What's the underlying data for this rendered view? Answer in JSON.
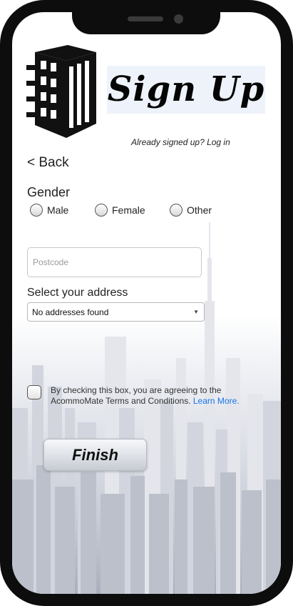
{
  "header": {
    "title": "Sign Up",
    "login_link": "Already signed up? Log in"
  },
  "nav": {
    "back_label": "< Back"
  },
  "gender": {
    "label": "Gender",
    "options": [
      "Male",
      "Female",
      "Other"
    ]
  },
  "postcode": {
    "placeholder": "Postcode",
    "value": ""
  },
  "address": {
    "label": "Select your address",
    "selected": "No addresses found"
  },
  "terms": {
    "text": "By checking this box, you are agreeing to the AcommoMate Terms and Conditions.",
    "link": "Learn More.",
    "checked": false
  },
  "actions": {
    "finish_label": "Finish"
  },
  "colors": {
    "link": "#1a73e8",
    "frame": "#0d0d0d"
  },
  "icons": {
    "logo": "building-icon",
    "select_caret": "caret-down-icon"
  }
}
